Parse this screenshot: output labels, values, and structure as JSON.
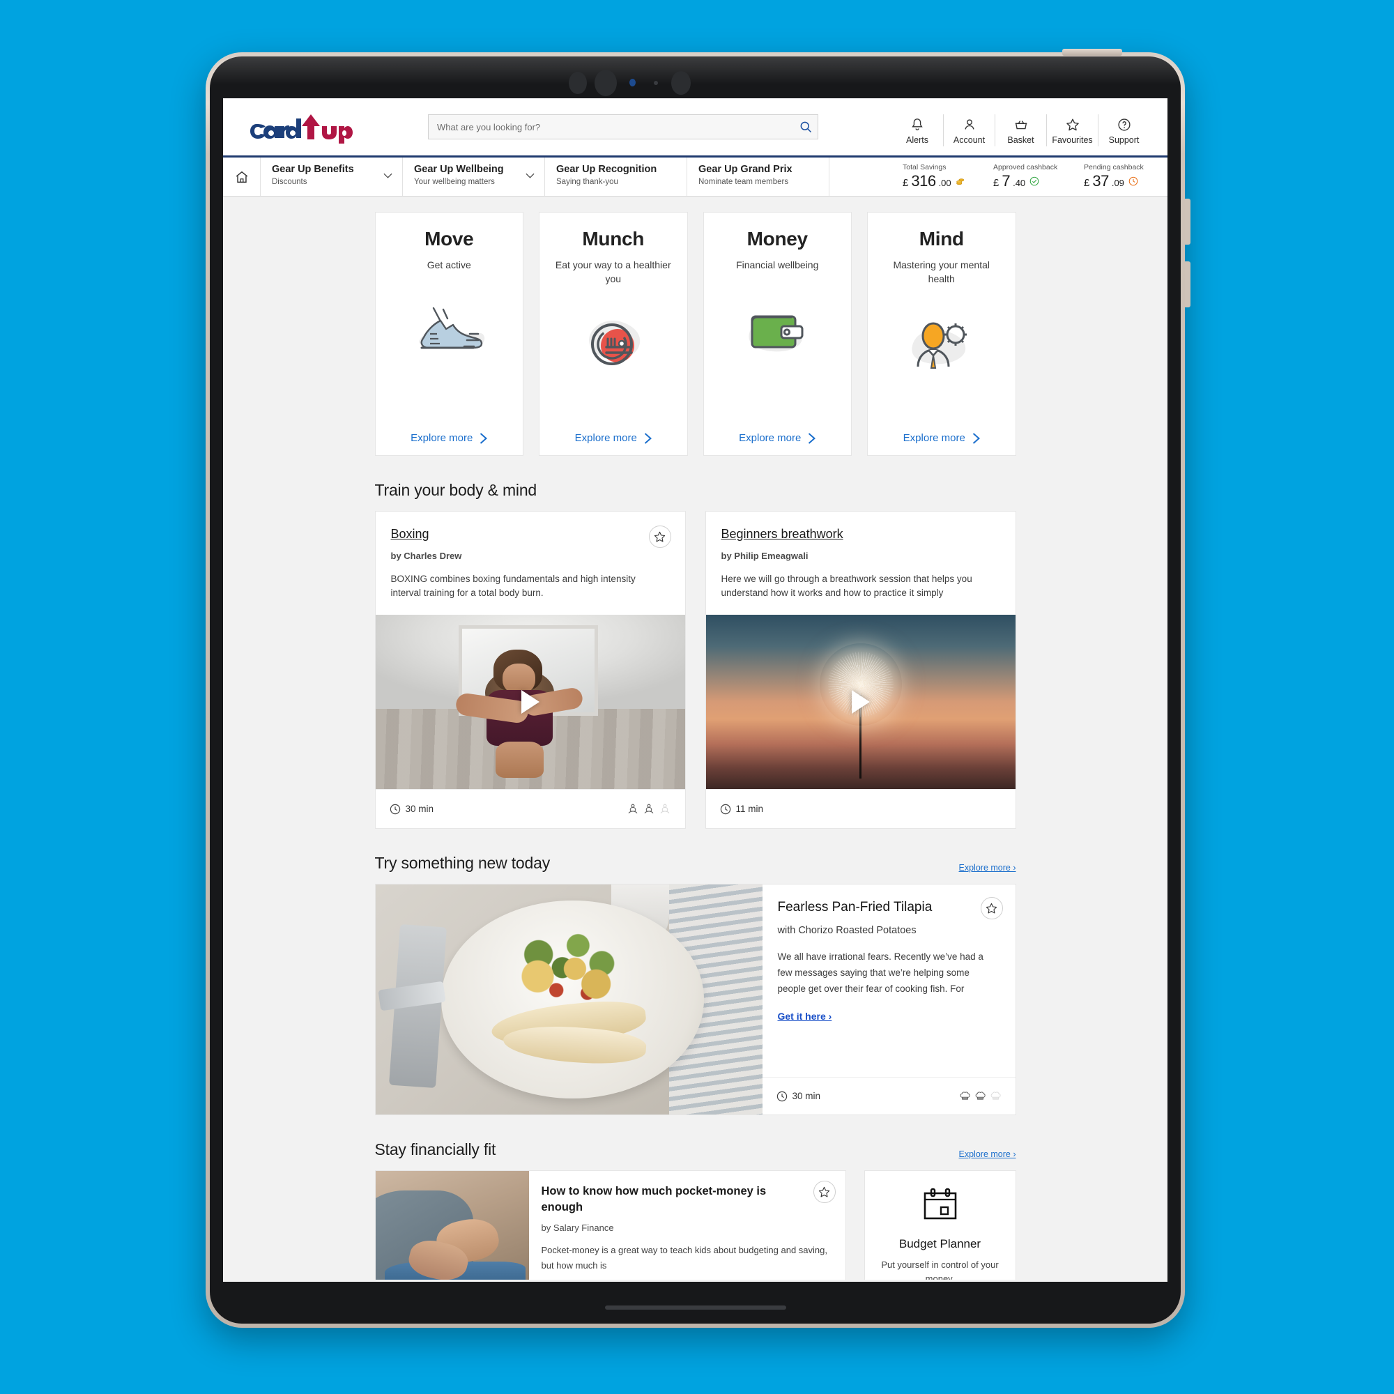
{
  "brand": {
    "name_part1": "Gear",
    "name_part2": "Up",
    "color_primary": "#1c3f7a",
    "color_accent": "#b01644"
  },
  "header": {
    "search": {
      "placeholder": "What are you looking for?",
      "value": ""
    },
    "actions": [
      {
        "label": "Alerts",
        "icon": "bell-icon"
      },
      {
        "label": "Account",
        "icon": "person-icon"
      },
      {
        "label": "Basket",
        "icon": "basket-icon"
      },
      {
        "label": "Favourites",
        "icon": "star-icon"
      },
      {
        "label": "Support",
        "icon": "question-circle-icon"
      }
    ]
  },
  "nav": {
    "home_icon": "home-icon",
    "items": [
      {
        "title": "Gear Up Benefits",
        "subtitle": "Discounts",
        "has_chevron": true
      },
      {
        "title": "Gear Up Wellbeing",
        "subtitle": "Your wellbeing matters",
        "has_chevron": true
      },
      {
        "title": "Gear Up Recognition",
        "subtitle": "Saying thank-you",
        "has_chevron": false
      },
      {
        "title": "Gear Up Grand Prix",
        "subtitle": "Nominate team members",
        "has_chevron": false
      }
    ],
    "stats": [
      {
        "caption": "Total Savings",
        "currency": "£",
        "amount": "316",
        "cents": ".00",
        "badge": "coins-icon",
        "badge_color": "#f0b323"
      },
      {
        "caption": "Approved cashback",
        "currency": "£",
        "amount": "7",
        "cents": ".40",
        "badge": "check-circle-icon",
        "badge_color": "#35a745"
      },
      {
        "caption": "Pending cashback",
        "currency": "£",
        "amount": "37",
        "cents": ".09",
        "badge": "clock-icon",
        "badge_color": "#e8711a"
      }
    ]
  },
  "tiles": [
    {
      "name": "Move",
      "subtitle": "Get active",
      "icon": "running-shoe-icon",
      "more": "Explore more"
    },
    {
      "name": "Munch",
      "subtitle": "Eat your way to a healthier you",
      "icon": "plate-fork-icon",
      "more": "Explore more"
    },
    {
      "name": "Money",
      "subtitle": "Financial wellbeing",
      "icon": "wallet-icon",
      "more": "Explore more"
    },
    {
      "name": "Mind",
      "subtitle": "Mastering your mental health",
      "icon": "person-gear-icon",
      "more": "Explore more"
    }
  ],
  "train_section": {
    "heading": "Train your body & mind",
    "cards": [
      {
        "title": "Boxing",
        "by": "by Charles Drew",
        "description": "BOXING combines boxing fundamentals and high intensity interval training for a total body burn.",
        "duration": "30 min",
        "duration_icon": "clock-icon",
        "favourite_icon": "star-outline-icon",
        "play_icon": "play-icon",
        "level_icon": "meditation-figure-icon",
        "level_filled": 2,
        "level_total": 3,
        "image": "boxing-photo"
      },
      {
        "title": "Beginners breathwork",
        "by": "by Philip Emeagwali",
        "description": "Here we will go through a breathwork session that helps you understand how it works and how to practice it simply",
        "duration": "11 min",
        "duration_icon": "clock-icon",
        "favourite_icon": "star-outline-icon",
        "play_icon": "play-icon",
        "level_icon": "meditation-figure-icon",
        "level_filled": 0,
        "level_total": 0,
        "image": "dandelion-sunset-photo"
      }
    ]
  },
  "try_section": {
    "heading": "Try something new today",
    "explore_label": "Explore more ›",
    "recipe": {
      "title": "Fearless Pan-Fried Tilapia",
      "subtitle": "with Chorizo Roasted Potatoes",
      "description": "We all have irrational fears. Recently we’ve had a few messages saying that we’re helping some people get over their fear of cooking fish. For",
      "cta": "Get it here ›",
      "duration": "30 min",
      "duration_icon": "clock-icon",
      "favourite_icon": "star-outline-icon",
      "level_icon": "chef-hat-icon",
      "level_filled": 2,
      "level_total": 3,
      "image": "pan-fried-tilapia-photo"
    }
  },
  "financial_section": {
    "heading": "Stay financially fit",
    "explore_label": "Explore more ›",
    "article": {
      "title": "How to know how much pocket-money is enough",
      "by": "by Salary Finance",
      "description": "Pocket-money is a great way to teach kids about budgeting and saving, but how much is",
      "favourite_icon": "star-outline-icon",
      "image": "pocket-money-photo"
    },
    "tool": {
      "name": "Budget Planner",
      "subtitle": "Put yourself in control of your money.",
      "icon": "calendar-icon"
    }
  }
}
